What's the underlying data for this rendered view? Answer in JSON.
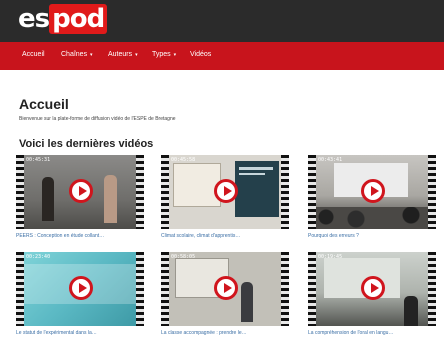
{
  "header": {
    "logo_prefix": "es",
    "logo_accent": "pod"
  },
  "nav": {
    "items": [
      {
        "label": "Accueil",
        "dropdown": false
      },
      {
        "label": "Chaînes",
        "dropdown": true
      },
      {
        "label": "Auteurs",
        "dropdown": true
      },
      {
        "label": "Types",
        "dropdown": true
      },
      {
        "label": "Vidéos",
        "dropdown": false
      }
    ],
    "caret": "▾"
  },
  "main": {
    "title": "Accueil",
    "subtitle": "Bienvenue sur la plate-forme de diffusion vidéo de l'ESPE de Bretagne",
    "section_title": "Voici les dernières vidéos"
  },
  "videos": [
    {
      "title": "PEERS : Conception en étude collant…",
      "duration": "00:45:31",
      "icon": "play-icon"
    },
    {
      "title": "Climat scolaire, climat d'apprentis…",
      "duration": "00:45:58",
      "icon": "play-icon"
    },
    {
      "title": "Pourquoi des erreurs ?",
      "duration": "00:43:41",
      "icon": "play-icon"
    },
    {
      "title": "Le statut de l'expérimental dans la…",
      "duration": "00:23:40",
      "icon": "play-icon"
    },
    {
      "title": "La classe accompagnée : prendre le…",
      "duration": "00:58:05",
      "icon": "play-icon"
    },
    {
      "title": "La compréhension de l'oral en langu…",
      "duration": "00:19:45",
      "icon": "play-icon"
    }
  ],
  "colors": {
    "header_bg": "#2b2b2b",
    "navbar_bg": "#c8141c",
    "accent": "#e01a1a",
    "link": "#3a6ea5"
  }
}
